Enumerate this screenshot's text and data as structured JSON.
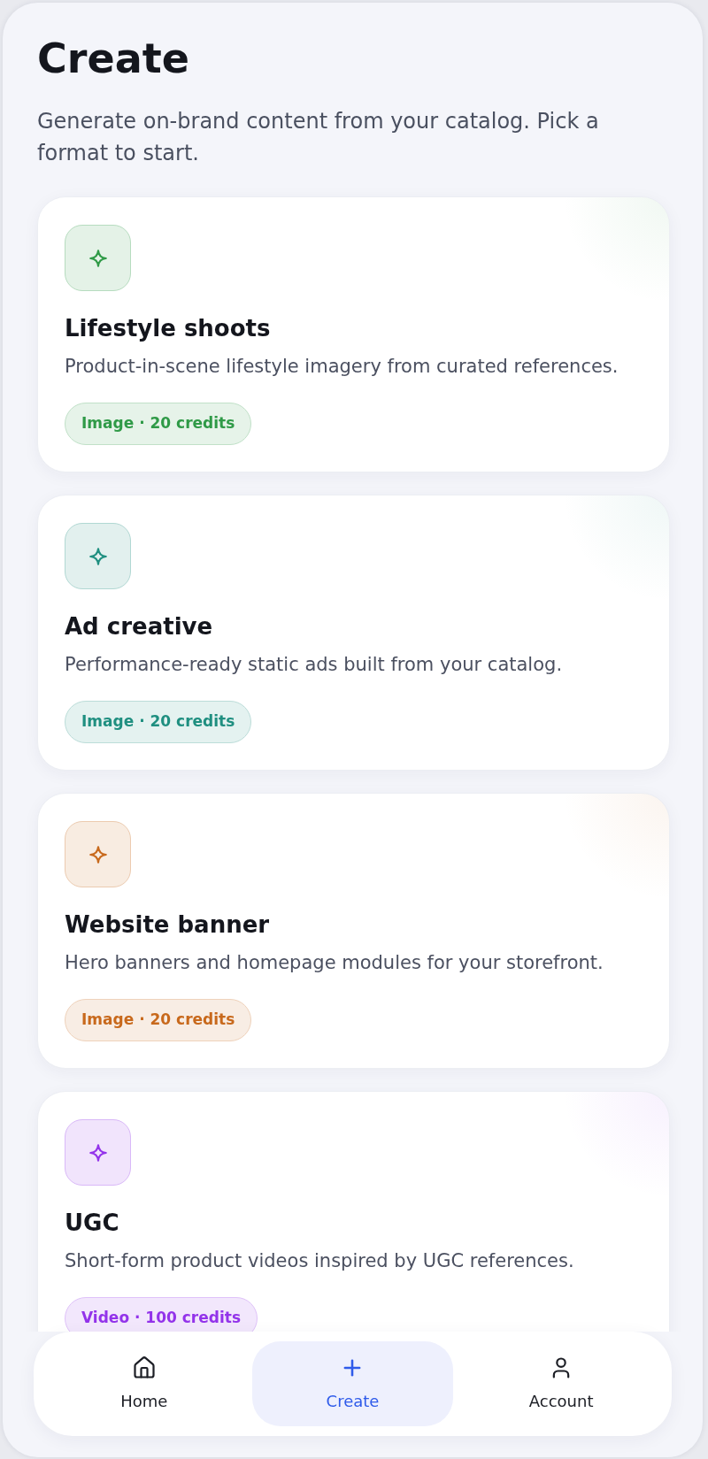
{
  "header": {
    "title": "Create",
    "subtitle": "Generate on-brand content from your catalog. Pick a format to start."
  },
  "cards": [
    {
      "title": "Lifestyle shoots",
      "description": "Product-in-scene lifestyle imagery from curated references.",
      "tag": "Image · 20 credits",
      "color": "#2f9a47"
    },
    {
      "title": "Ad creative",
      "description": "Performance-ready static ads built from your catalog.",
      "tag": "Image · 20 credits",
      "color": "#1f8f80"
    },
    {
      "title": "Website banner",
      "description": "Hero banners and homepage modules for your storefront.",
      "tag": "Image · 20 credits",
      "color": "#c8691c"
    },
    {
      "title": "UGC",
      "description": "Short-form product videos inspired by UGC references.",
      "tag": "Video · 100 credits",
      "color": "#9333ea"
    }
  ],
  "nav": [
    {
      "kind": "home",
      "label": "Home",
      "selected": false
    },
    {
      "kind": "create",
      "label": "Create",
      "selected": true
    },
    {
      "kind": "account",
      "label": "Account",
      "selected": false
    }
  ]
}
